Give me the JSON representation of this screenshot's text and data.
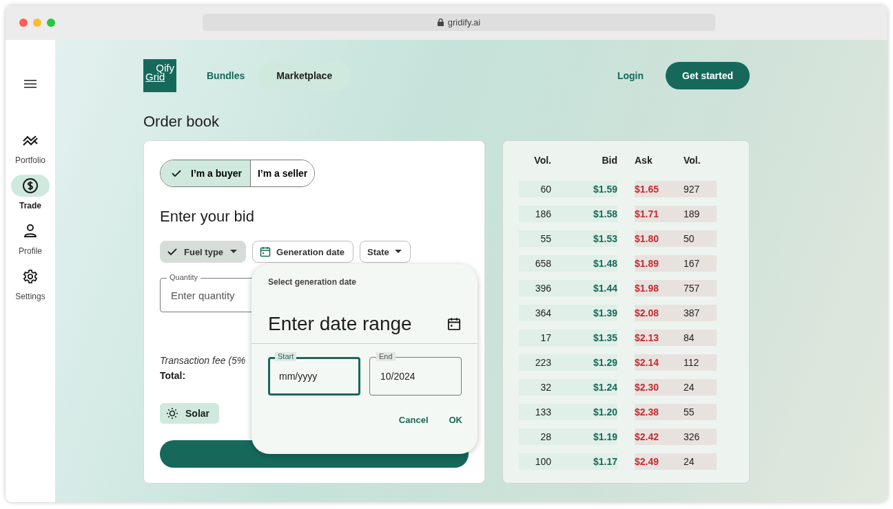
{
  "browser": {
    "url": "gridify.ai"
  },
  "sidebar": {
    "items": [
      {
        "label": "Portfolio",
        "selected": false
      },
      {
        "label": "Trade",
        "selected": true
      },
      {
        "label": "Profile",
        "selected": false
      },
      {
        "label": "Settings",
        "selected": false
      }
    ]
  },
  "nav": {
    "logo": [
      "Qify",
      "Grid"
    ],
    "links": [
      {
        "label": "Bundles",
        "selected": false
      },
      {
        "label": "Marketplace",
        "selected": true
      }
    ],
    "login": "Login",
    "cta": "Get started"
  },
  "page_title": "Order book",
  "bid_form": {
    "roles": [
      {
        "label": "I’m a buyer",
        "selected": true
      },
      {
        "label": "I’m a seller",
        "selected": false
      }
    ],
    "heading": "Enter your bid",
    "filters": [
      {
        "label": "Fuel type",
        "kind": "dropdown",
        "selected": true
      },
      {
        "label": "Generation date",
        "kind": "date",
        "selected": false
      },
      {
        "label": "State",
        "kind": "dropdown",
        "selected": false
      }
    ],
    "quantity": {
      "label": "Quantity",
      "placeholder": "Enter quantity"
    },
    "fee_label": "Transaction fee (5%",
    "total_label": "Total:",
    "tags": [
      "Solar"
    ]
  },
  "date_picker": {
    "title": "Select generation date",
    "heading": "Enter date range",
    "fields": [
      {
        "label": "Start",
        "placeholder": "mm/yyyy",
        "focused": true
      },
      {
        "label": "End",
        "value": "10/2024",
        "focused": false
      }
    ],
    "actions": [
      "Cancel",
      "OK"
    ]
  },
  "order_book": {
    "columns": [
      "Vol.",
      "Bid",
      "Ask",
      "Vol."
    ],
    "rows": [
      {
        "bid_vol": "60",
        "bid": "$1.59",
        "ask": "$1.65",
        "ask_vol": "927"
      },
      {
        "bid_vol": "186",
        "bid": "$1.58",
        "ask": "$1.71",
        "ask_vol": "189"
      },
      {
        "bid_vol": "55",
        "bid": "$1.53",
        "ask": "$1.80",
        "ask_vol": "50"
      },
      {
        "bid_vol": "658",
        "bid": "$1.48",
        "ask": "$1.89",
        "ask_vol": "167"
      },
      {
        "bid_vol": "396",
        "bid": "$1.44",
        "ask": "$1.98",
        "ask_vol": "757"
      },
      {
        "bid_vol": "364",
        "bid": "$1.39",
        "ask": "$2.08",
        "ask_vol": "387"
      },
      {
        "bid_vol": "17",
        "bid": "$1.35",
        "ask": "$2.13",
        "ask_vol": "84"
      },
      {
        "bid_vol": "223",
        "bid": "$1.29",
        "ask": "$2.14",
        "ask_vol": "112"
      },
      {
        "bid_vol": "32",
        "bid": "$1.24",
        "ask": "$2.30",
        "ask_vol": "24"
      },
      {
        "bid_vol": "133",
        "bid": "$1.20",
        "ask": "$2.38",
        "ask_vol": "55"
      },
      {
        "bid_vol": "28",
        "bid": "$1.19",
        "ask": "$2.42",
        "ask_vol": "326"
      },
      {
        "bid_vol": "100",
        "bid": "$1.17",
        "ask": "$2.49",
        "ask_vol": "24"
      }
    ]
  }
}
